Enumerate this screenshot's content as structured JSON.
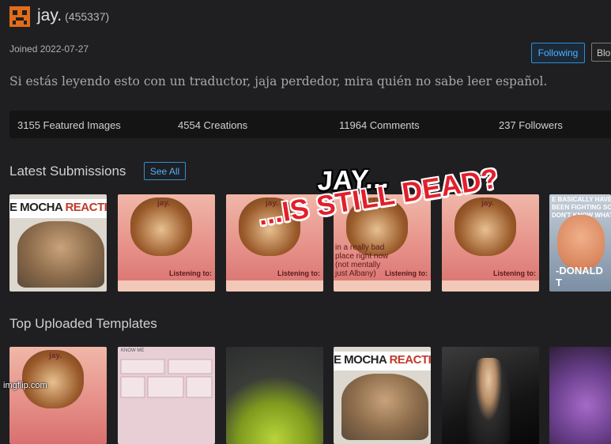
{
  "profile": {
    "username": "jay.",
    "user_id": "(455337)",
    "joined": "Joined 2022-07-27",
    "bio": "Si estás leyendo esto con un traductor, jaja perdedor, mira quién no sabe leer español.",
    "follow_label": "Following",
    "block_label": "Blo"
  },
  "stats": {
    "featured": "3155 Featured Images",
    "creations": "4554 Creations",
    "comments": "11964 Comments",
    "followers": "237 Followers"
  },
  "sections": {
    "latest": "Latest Submissions",
    "see_all": "See All",
    "top": "Top Uploaded Templates"
  },
  "thumbs": {
    "mocha_a": "E MOCHA ",
    "mocha_b": "REACTIO",
    "jay_label": "jay.",
    "listening": "Listening to:",
    "trump_caption": "E BASICALLY HAVE TWO C T BEEN FIGHTING SO HARD EY DON'T KNOW WHAT TH",
    "trump_name": "-DONALD T",
    "template_header": "KNOW ME"
  },
  "overlay": {
    "line1": "JAY...",
    "line2": "...IS STILL DEAD?",
    "small_text": "in a really bad place right now (not mentally just Albany)"
  },
  "watermark": "imgflip.com",
  "colors": {
    "accent": "#2d8fd5",
    "headline_red": "#e21f2b",
    "avatar_orange": "#e26c1a"
  }
}
